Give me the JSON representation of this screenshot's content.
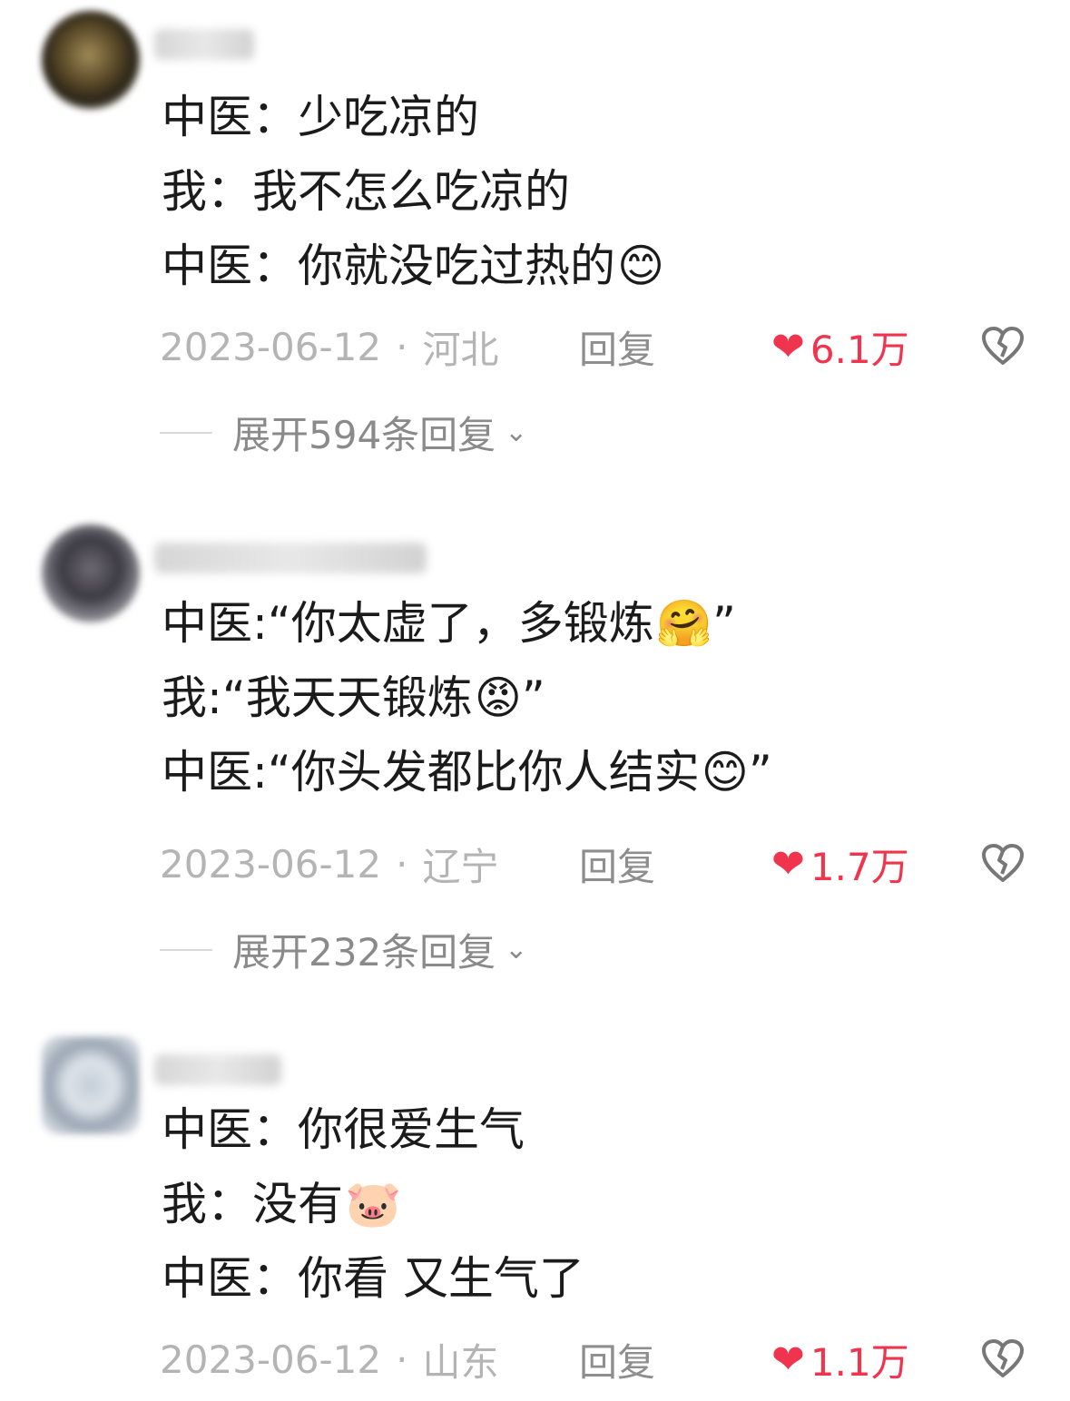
{
  "comments": [
    {
      "lines": [
        {
          "text": "中医：少吃凉的",
          "emoji": ""
        },
        {
          "text": "我：我不怎么吃凉的",
          "emoji": ""
        },
        {
          "text": "中医：你就没吃过热的",
          "emoji": "😊"
        }
      ],
      "date": "2023-06-12",
      "separator": "·",
      "location": "河北",
      "reply_label": "回复",
      "likes": "6.1万",
      "expand_label": "展开594条回复",
      "icons": {
        "like": "heart-icon",
        "dislike": "broken-heart-icon",
        "expand": "chevron-down-icon"
      }
    },
    {
      "lines": [
        {
          "text": "中医:“你太虚了，多锻炼",
          "emoji": "🤗",
          "tail": "”"
        },
        {
          "text": "我:“我天天锻炼",
          "emoji": "😡",
          "tail": "”"
        },
        {
          "text": "中医:“你头发都比你人结实",
          "emoji": "😊",
          "tail": "”"
        }
      ],
      "date": "2023-06-12",
      "separator": "·",
      "location": "辽宁",
      "reply_label": "回复",
      "likes": "1.7万",
      "expand_label": "展开232条回复",
      "icons": {
        "like": "heart-icon",
        "dislike": "broken-heart-icon",
        "expand": "chevron-down-icon"
      }
    },
    {
      "lines": [
        {
          "text": "中医：你很爱生气",
          "emoji": ""
        },
        {
          "text": "我：没有",
          "emoji": "🐷"
        },
        {
          "text": "中医：你看 又生气了",
          "emoji": ""
        }
      ],
      "date": "2023-06-12",
      "separator": "·",
      "location": "山东",
      "reply_label": "回复",
      "likes": "1.1万",
      "icons": {
        "like": "heart-icon",
        "dislike": "broken-heart-icon"
      }
    }
  ],
  "colors": {
    "like_red": "#f1344e",
    "meta_gray": "#b4b4b4",
    "text": "#1b1b1b"
  }
}
